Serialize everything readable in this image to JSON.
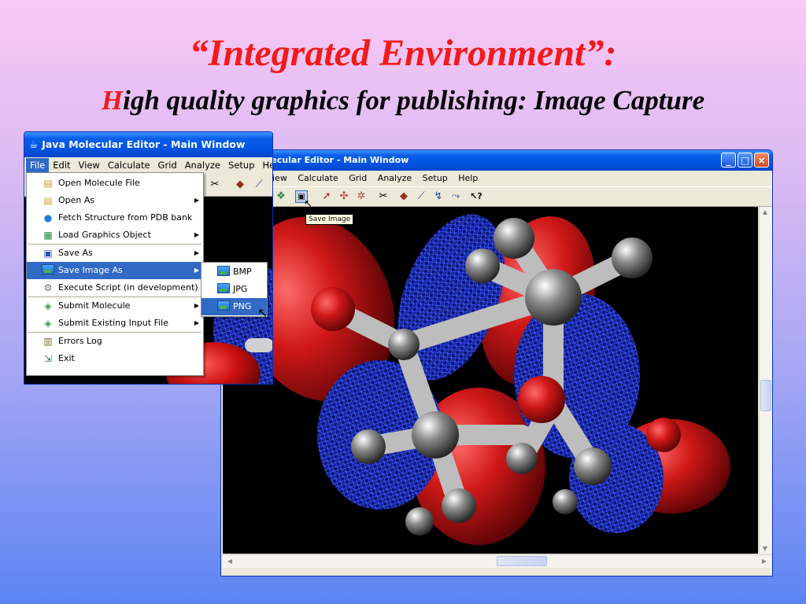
{
  "slide": {
    "title": "“Integrated Environment”:",
    "subtitle_first_letter": "H",
    "subtitle_rest": "igh quality graphics for publishing: Image Capture"
  },
  "main_window": {
    "title": "olecular Editor - Main Window",
    "menu": [
      "iew",
      "Calculate",
      "Grid",
      "Analyze",
      "Setup",
      "Help"
    ],
    "controls": {
      "minimize": "_",
      "maximize": "□",
      "close": "×"
    },
    "tooltip": "Save Image",
    "toolbar_icons": [
      "open-model-icon",
      "save-image-icon",
      "bond-tool-icon",
      "atom-tool-icon",
      "fragment-tool-icon",
      "cut-icon",
      "render-icon",
      "stick-icon",
      "ring-icon",
      "chain-icon",
      "help-pointer-icon"
    ]
  },
  "front_window": {
    "title": "Java Molecular Editor - Main Window",
    "menu": [
      "File",
      "Edit",
      "View",
      "Calculate",
      "Grid",
      "Analyze",
      "Setup",
      "He"
    ],
    "active_menu": "File"
  },
  "file_menu": {
    "groups": [
      [
        {
          "label": "Open Molecule File",
          "icon": "folder-open-icon",
          "submenu": false
        },
        {
          "label": "Open As",
          "icon": "folder-open-icon",
          "submenu": true
        },
        {
          "label": "Fetch Structure from PDB bank",
          "icon": "globe-icon",
          "submenu": false
        },
        {
          "label": "Load Graphics Object",
          "icon": "graphics-load-icon",
          "submenu": true
        }
      ],
      [
        {
          "label": "Save As",
          "icon": "floppy-disk-icon",
          "submenu": true
        },
        {
          "label": "Save Image As",
          "icon": "image-icon",
          "submenu": true,
          "highlighted": true
        },
        {
          "label": "Execute Script (in development)",
          "icon": "gear-icon",
          "submenu": false
        }
      ],
      [
        {
          "label": "Submit Molecule",
          "icon": "submit-icon",
          "submenu": true
        },
        {
          "label": "Submit Existing Input File",
          "icon": "submit-file-icon",
          "submenu": true
        }
      ],
      [
        {
          "label": "Errors Log",
          "icon": "log-icon",
          "submenu": false
        },
        {
          "label": "Exit",
          "icon": "exit-icon",
          "submenu": false
        }
      ]
    ]
  },
  "image_submenu": {
    "items": [
      {
        "label": "BMP",
        "highlighted": false
      },
      {
        "label": "JPG",
        "highlighted": false
      },
      {
        "label": "PNG",
        "highlighted": true
      }
    ]
  },
  "colors": {
    "title_red": "#f21a1a",
    "highlight": "#316ac5",
    "xp_blue": "#0052e0",
    "orbital_red": "#c8141c",
    "orbital_blue": "#1a2fd8"
  }
}
